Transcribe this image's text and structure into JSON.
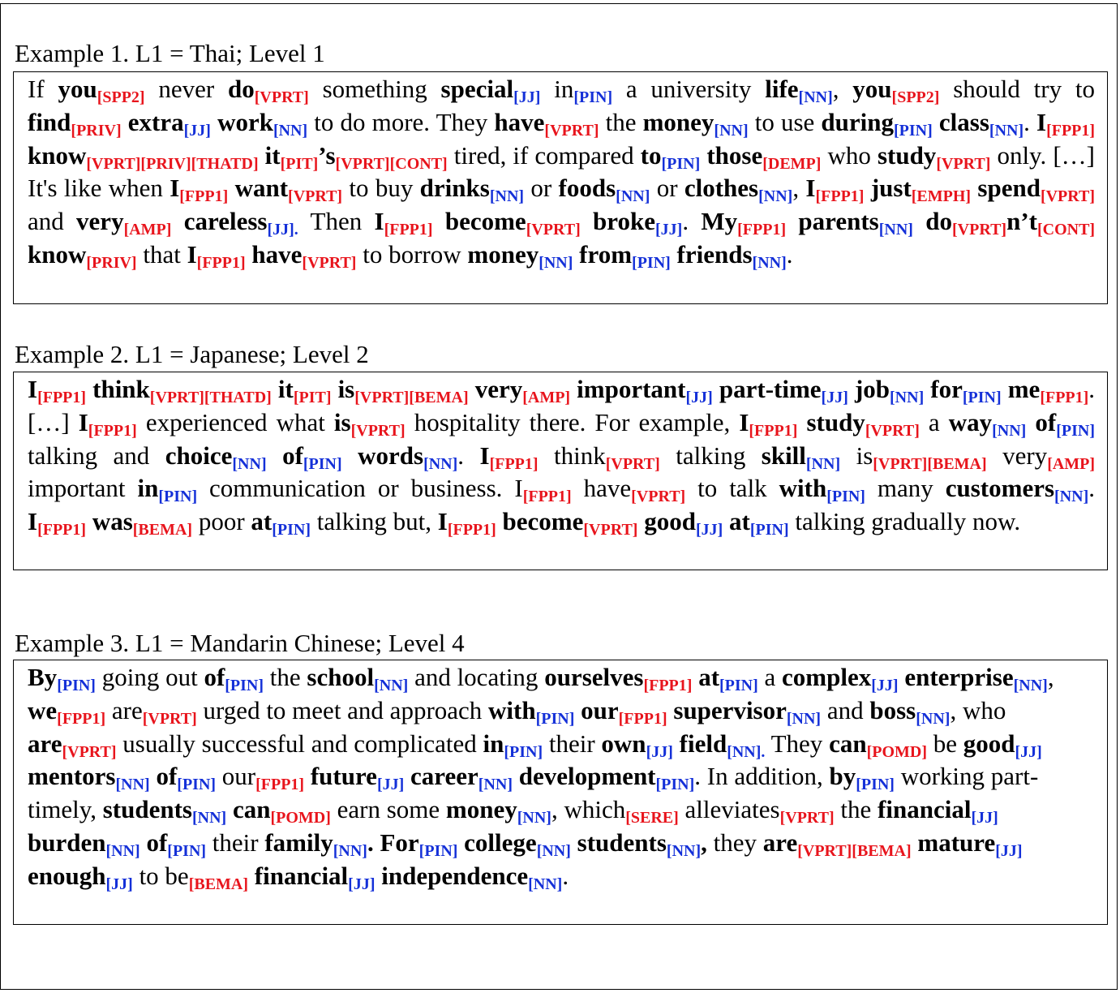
{
  "examples": [
    {
      "heading": "Example 1. L1 = Thai; Level 1",
      "tokens": [
        {
          "w": "If "
        },
        {
          "w": "you",
          "b": 1,
          "t": "[SPP2]",
          "c": "r"
        },
        {
          "w": " never "
        },
        {
          "w": "do",
          "b": 1,
          "t": "[VPRT]",
          "c": "r"
        },
        {
          "w": " something "
        },
        {
          "w": "special",
          "b": 1,
          "t": "[JJ]",
          "c": "u"
        },
        {
          "w": " in",
          "t": "[PIN]",
          "c": "u"
        },
        {
          "w": " a university "
        },
        {
          "w": "life",
          "b": 1,
          "t": "[NN]",
          "c": "u"
        },
        {
          "w": ", "
        },
        {
          "w": "you",
          "b": 1,
          "t": "[SPP2]",
          "c": "r"
        },
        {
          "w": " should try to "
        },
        {
          "w": "find",
          "b": 1,
          "t": "[PRIV]",
          "c": "r"
        },
        {
          "w": " "
        },
        {
          "w": "extra",
          "b": 1,
          "t": "[JJ]",
          "c": "u"
        },
        {
          "w": " "
        },
        {
          "w": "work",
          "b": 1,
          "t": "[NN]",
          "c": "u"
        },
        {
          "w": " to do more. They "
        },
        {
          "w": "have",
          "b": 1,
          "t": "[VPRT]",
          "c": "r"
        },
        {
          "w": " the "
        },
        {
          "w": "money",
          "b": 1,
          "t": "[NN]",
          "c": "u"
        },
        {
          "w": " to use "
        },
        {
          "w": "during",
          "b": 1,
          "t": "[PIN]",
          "c": "u"
        },
        {
          "w": " "
        },
        {
          "w": "class",
          "b": 1,
          "t": "[NN]",
          "c": "u"
        },
        {
          "w": ". "
        },
        {
          "w": "I",
          "b": 1,
          "t": "[FPP1]",
          "c": "r"
        },
        {
          "w": " "
        },
        {
          "w": "know",
          "b": 1,
          "t": "[VPRT][PRIV][THATD]",
          "c": "r"
        },
        {
          "w": " "
        },
        {
          "w": "it",
          "b": 1,
          "t": "[PIT]",
          "c": "r"
        },
        {
          "w": "’s",
          "b": 1,
          "t": "[VPRT][CONT]",
          "c": "r"
        },
        {
          "w": " tired, if compared "
        },
        {
          "w": "to",
          "b": 1,
          "t": "[PIN]",
          "c": "u"
        },
        {
          "w": " "
        },
        {
          "w": "those",
          "b": 1,
          "t": "[DEMP]",
          "c": "r"
        },
        {
          "w": " who "
        },
        {
          "w": "study",
          "b": 1,
          "t": "[VPRT]",
          "c": "r"
        },
        {
          "w": " only. […] It's like when "
        },
        {
          "w": "I",
          "b": 1,
          "t": "[FPP1]",
          "c": "r"
        },
        {
          "w": " "
        },
        {
          "w": "want",
          "b": 1,
          "t": "[VPRT]",
          "c": "r"
        },
        {
          "w": " to buy "
        },
        {
          "w": "drinks",
          "b": 1,
          "t": "[NN]",
          "c": "u"
        },
        {
          "w": " or "
        },
        {
          "w": "foods",
          "b": 1,
          "t": "[NN]",
          "c": "u"
        },
        {
          "w": " or "
        },
        {
          "w": "clothes",
          "b": 1,
          "t": "[NN]",
          "c": "u"
        },
        {
          "w": ", "
        },
        {
          "w": "I",
          "b": 1,
          "t": "[FPP1]",
          "c": "r"
        },
        {
          "w": " "
        },
        {
          "w": "just",
          "b": 1,
          "t": "[EMPH]",
          "c": "r"
        },
        {
          "w": " "
        },
        {
          "w": "spend",
          "b": 1,
          "t": "[VPRT]",
          "c": "r"
        },
        {
          "w": " and "
        },
        {
          "w": "very",
          "b": 1,
          "t": "[AMP]",
          "c": "r"
        },
        {
          "w": " "
        },
        {
          "w": "careless",
          "b": 1,
          "t": "[JJ].",
          "c": "u"
        },
        {
          "w": " Then "
        },
        {
          "w": "I",
          "b": 1,
          "t": "[FPP1]",
          "c": "r"
        },
        {
          "w": " "
        },
        {
          "w": "become",
          "b": 1,
          "t": "[VPRT]",
          "c": "r"
        },
        {
          "w": " "
        },
        {
          "w": "broke",
          "b": 1,
          "t": "[JJ]",
          "c": "u"
        },
        {
          "w": ". "
        },
        {
          "w": "My",
          "b": 1,
          "t": "[FPP1]",
          "c": "r"
        },
        {
          "w": " "
        },
        {
          "w": "parents",
          "b": 1,
          "t": "[NN]",
          "c": "u"
        },
        {
          "w": " "
        },
        {
          "w": "do",
          "b": 1,
          "t": "[VPRT]",
          "c": "r"
        },
        {
          "w": "n’t",
          "b": 1,
          "t": "[CONT]",
          "c": "r"
        },
        {
          "w": " "
        },
        {
          "w": "know",
          "b": 1,
          "t": "[PRIV]",
          "c": "r"
        },
        {
          "w": " that "
        },
        {
          "w": "I",
          "b": 1,
          "t": "[FPP1]",
          "c": "r"
        },
        {
          "w": " "
        },
        {
          "w": "have",
          "b": 1,
          "t": "[VPRT]",
          "c": "r"
        },
        {
          "w": " to borrow "
        },
        {
          "w": "money",
          "b": 1,
          "t": "[NN]",
          "c": "u"
        },
        {
          "w": " "
        },
        {
          "w": "from",
          "b": 1,
          "t": "[PIN]",
          "c": "u"
        },
        {
          "w": " "
        },
        {
          "w": "friends",
          "b": 1,
          "t": "[NN]",
          "c": "u"
        },
        {
          "w": "."
        }
      ]
    },
    {
      "heading": "Example 2. L1 = Japanese; Level 2",
      "tokens": [
        {
          "w": "I",
          "b": 1,
          "t": "[FPP1]",
          "c": "r"
        },
        {
          "w": " "
        },
        {
          "w": "think",
          "b": 1,
          "t": "[VPRT][THATD]",
          "c": "r"
        },
        {
          "w": " "
        },
        {
          "w": "it",
          "b": 1,
          "t": "[PIT]",
          "c": "r"
        },
        {
          "w": " "
        },
        {
          "w": "is",
          "b": 1,
          "t": "[VPRT][BEMA]",
          "c": "r"
        },
        {
          "w": " "
        },
        {
          "w": "very",
          "b": 1,
          "t": "[AMP]",
          "c": "r"
        },
        {
          "w": " "
        },
        {
          "w": "important",
          "b": 1,
          "t": "[JJ]",
          "c": "u"
        },
        {
          "w": " "
        },
        {
          "w": "part-time",
          "b": 1,
          "t": "[JJ]",
          "c": "u"
        },
        {
          "w": " "
        },
        {
          "w": "job",
          "b": 1,
          "t": "[NN]",
          "c": "u"
        },
        {
          "w": " "
        },
        {
          "w": "for",
          "b": 1,
          "t": "[PIN]",
          "c": "u"
        },
        {
          "w": " "
        },
        {
          "w": "me",
          "b": 1,
          "t": "[FPP1]",
          "c": "r"
        },
        {
          "w": ". […] "
        },
        {
          "w": "I",
          "b": 1,
          "t": "[FPP1]",
          "c": "r"
        },
        {
          "w": " experienced what "
        },
        {
          "w": "is",
          "b": 1,
          "t": "[VPRT]",
          "c": "r"
        },
        {
          "w": " hospitality there. For example, "
        },
        {
          "w": "I",
          "b": 1,
          "t": "[FPP1]",
          "c": "r"
        },
        {
          "w": " "
        },
        {
          "w": "study",
          "b": 1,
          "t": "[VPRT]",
          "c": "r"
        },
        {
          "w": " a "
        },
        {
          "w": "way",
          "b": 1,
          "t": "[NN]",
          "c": "u"
        },
        {
          "w": " "
        },
        {
          "w": "of",
          "b": 1,
          "t": "[PIN]",
          "c": "u"
        },
        {
          "w": " talking and "
        },
        {
          "w": "choice",
          "b": 1,
          "t": "[NN]",
          "c": "u"
        },
        {
          "w": " "
        },
        {
          "w": "of",
          "b": 1,
          "t": "[PIN]",
          "c": "u"
        },
        {
          "w": " "
        },
        {
          "w": "words",
          "b": 1,
          "t": "[NN]",
          "c": "u"
        },
        {
          "w": ". "
        },
        {
          "w": "I",
          "b": 1,
          "t": "[FPP1]",
          "c": "r"
        },
        {
          "w": " think",
          "t": "[VPRT]",
          "c": "r"
        },
        {
          "w": " talking "
        },
        {
          "w": "skill",
          "b": 1,
          "t": "[NN]",
          "c": "u"
        },
        {
          "w": " is",
          "t": "[VPRT][BEMA]",
          "c": "r"
        },
        {
          "w": " very",
          "t": "[AMP]",
          "c": "r"
        },
        {
          "w": " important "
        },
        {
          "w": "in",
          "b": 1,
          "t": "[PIN]",
          "c": "u"
        },
        {
          "w": " communication or business. I",
          "t": "[FPP1]",
          "c": "r"
        },
        {
          "w": " have",
          "t": "[VPRT]",
          "c": "r"
        },
        {
          "w": " to talk "
        },
        {
          "w": "with",
          "b": 1,
          "t": "[PIN]",
          "c": "u"
        },
        {
          "w": " many "
        },
        {
          "w": "customers",
          "b": 1,
          "t": "[NN]",
          "c": "u"
        },
        {
          "w": ". "
        },
        {
          "w": "I",
          "b": 1,
          "t": "[FPP1]",
          "c": "r"
        },
        {
          "w": " "
        },
        {
          "w": "was",
          "b": 1,
          "t": "[BEMA]",
          "c": "r"
        },
        {
          "w": " poor "
        },
        {
          "w": "at",
          "b": 1,
          "t": "[PIN]",
          "c": "u"
        },
        {
          "w": " talking but, "
        },
        {
          "w": "I",
          "b": 1,
          "t": "[FPP1]",
          "c": "r"
        },
        {
          "w": " "
        },
        {
          "w": "become",
          "b": 1,
          "t": "[VPRT]",
          "c": "r"
        },
        {
          "w": " "
        },
        {
          "w": "good",
          "b": 1,
          "t": "[JJ]",
          "c": "u"
        },
        {
          "w": " "
        },
        {
          "w": "at",
          "b": 1,
          "t": "[PIN]",
          "c": "u"
        },
        {
          "w": " talking gradually now."
        }
      ]
    },
    {
      "heading": "Example 3. L1 = Mandarin Chinese; Level 4",
      "tokens": [
        {
          "w": "By",
          "b": 1,
          "t": "[PIN]",
          "c": "u"
        },
        {
          "w": " going out "
        },
        {
          "w": "of",
          "b": 1,
          "t": "[PIN]",
          "c": "u"
        },
        {
          "w": " the "
        },
        {
          "w": "school",
          "b": 1,
          "t": "[NN]",
          "c": "u"
        },
        {
          "w": " and locating "
        },
        {
          "w": "ourselves",
          "b": 1,
          "t": "[FPP1]",
          "c": "r"
        },
        {
          "w": " "
        },
        {
          "w": "at",
          "b": 1,
          "t": "[PIN]",
          "c": "u"
        },
        {
          "w": " a "
        },
        {
          "w": "complex",
          "b": 1,
          "t": "[JJ]",
          "c": "u"
        },
        {
          "w": " "
        },
        {
          "w": "enterprise",
          "b": 1,
          "t": "[NN]",
          "c": "u"
        },
        {
          "w": ", "
        },
        {
          "w": "we",
          "b": 1,
          "t": "[FPP1]",
          "c": "r"
        },
        {
          "w": " are",
          "t": "[VPRT]",
          "c": "r"
        },
        {
          "w": " urged to meet and approach "
        },
        {
          "w": "with",
          "b": 1,
          "t": "[PIN]",
          "c": "u"
        },
        {
          "w": " "
        },
        {
          "w": "our",
          "b": 1,
          "t": "[FPP1]",
          "c": "r"
        },
        {
          "w": " "
        },
        {
          "w": "supervisor",
          "b": 1,
          "t": "[NN]",
          "c": "u"
        },
        {
          "w": " and "
        },
        {
          "w": "boss",
          "b": 1,
          "t": "[NN]",
          "c": "u"
        },
        {
          "w": ", who "
        },
        {
          "w": "are",
          "b": 1,
          "t": "[VPRT]",
          "c": "r"
        },
        {
          "w": " usually successful and complicated "
        },
        {
          "w": "in",
          "b": 1,
          "t": "[PIN]",
          "c": "u"
        },
        {
          "w": " their "
        },
        {
          "w": "own",
          "b": 1,
          "t": "[JJ]",
          "c": "u"
        },
        {
          "w": " "
        },
        {
          "w": "field",
          "b": 1,
          "t": "[NN].",
          "c": "u"
        },
        {
          "w": " They "
        },
        {
          "w": "can",
          "b": 1,
          "t": "[POMD]",
          "c": "r"
        },
        {
          "w": " be "
        },
        {
          "w": "good",
          "b": 1,
          "t": "[JJ]",
          "c": "u"
        },
        {
          "w": " "
        },
        {
          "w": "mentors",
          "b": 1,
          "t": "[NN]",
          "c": "u"
        },
        {
          "w": " "
        },
        {
          "w": "of",
          "b": 1,
          "t": "[PIN]",
          "c": "u"
        },
        {
          "w": " our",
          "t": "[FPP1]",
          "c": "r"
        },
        {
          "w": " "
        },
        {
          "w": "future",
          "b": 1,
          "t": "[JJ]",
          "c": "u"
        },
        {
          "w": " "
        },
        {
          "w": "career",
          "b": 1,
          "t": "[NN]",
          "c": "u"
        },
        {
          "w": " "
        },
        {
          "w": "development",
          "b": 1,
          "t": "[PIN]",
          "c": "u"
        },
        {
          "w": ". In addition, "
        },
        {
          "w": "by",
          "b": 1,
          "t": "[PIN]",
          "c": "u"
        },
        {
          "w": " working part-timely, "
        },
        {
          "w": "students",
          "b": 1,
          "t": "[NN]",
          "c": "u"
        },
        {
          "w": " "
        },
        {
          "w": "can",
          "b": 1,
          "t": "[POMD]",
          "c": "r"
        },
        {
          "w": " earn some "
        },
        {
          "w": "money",
          "b": 1,
          "t": "[NN]",
          "c": "u"
        },
        {
          "w": ", which",
          "t": "[SERE]",
          "c": "r"
        },
        {
          "w": " alleviates",
          "t": "[VPRT]",
          "c": "r"
        },
        {
          "w": " the "
        },
        {
          "w": "financial",
          "b": 1,
          "t": "[JJ]",
          "c": "u"
        },
        {
          "w": " "
        },
        {
          "w": "burden",
          "b": 1,
          "t": "[NN]",
          "c": "u"
        },
        {
          "w": " "
        },
        {
          "w": "of",
          "b": 1,
          "t": "[PIN]",
          "c": "u"
        },
        {
          "w": " their "
        },
        {
          "w": "family",
          "b": 1,
          "t": "[NN]",
          "c": "u"
        },
        {
          "w": ". For",
          "b": 1,
          "t": "[PIN]",
          "c": "u"
        },
        {
          "w": " "
        },
        {
          "w": "college",
          "b": 1,
          "t": "[NN]",
          "c": "u"
        },
        {
          "w": " "
        },
        {
          "w": "students",
          "b": 1,
          "t": "[NN]",
          "c": "u"
        },
        {
          "w": ",",
          "b": 1
        },
        {
          "w": " they "
        },
        {
          "w": "are",
          "b": 1,
          "t": "[VPRT][BEMA]",
          "c": "r"
        },
        {
          "w": " "
        },
        {
          "w": "mature",
          "b": 1,
          "t": "[JJ]",
          "c": "u"
        },
        {
          "w": " "
        },
        {
          "w": "enough",
          "b": 1,
          "t": "[JJ]",
          "c": "u"
        },
        {
          "w": " to be",
          "t": "[BEMA]",
          "c": "r"
        },
        {
          "w": " "
        },
        {
          "w": "financial",
          "b": 1,
          "t": "[JJ]",
          "c": "u"
        },
        {
          "w": " "
        },
        {
          "w": "independence",
          "b": 1,
          "t": "[NN]",
          "c": "u"
        },
        {
          "w": "."
        }
      ]
    }
  ]
}
